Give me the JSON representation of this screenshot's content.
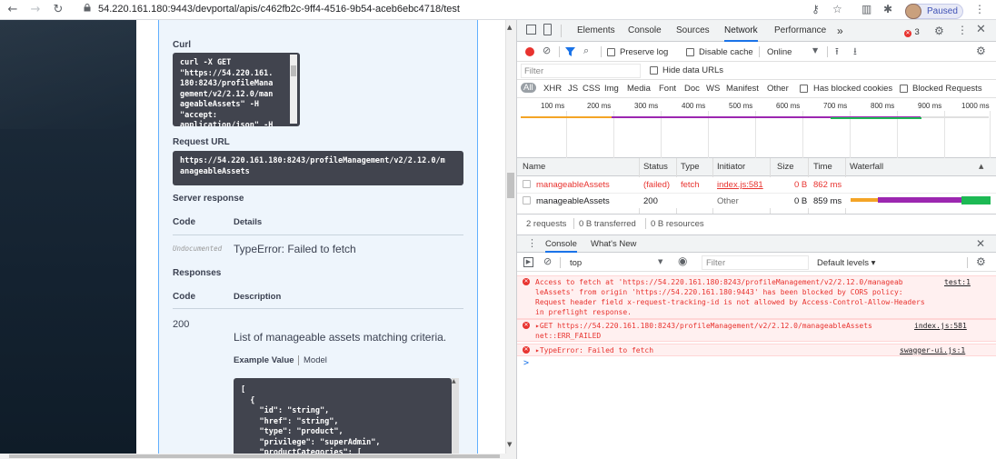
{
  "browser": {
    "url": "54.220.161.180:9443/devportal/apis/c462fb2c-9ff4-4516-9b54-aceb6ebc4718/test",
    "paused_label": "Paused"
  },
  "swagger": {
    "curl_heading": "Curl",
    "curl_code": "curl -X GET\n\"https://54.220.161.\n180:8243/profileMana\ngement/v2/2.12.0/man\nageableAssets\" -H\n\"accept:\napplication/json\" -H",
    "request_url_heading": "Request URL",
    "request_url": "https://54.220.161.180:8243/profileManagement/v2/2.12.0/m\nanageableAssets",
    "server_response_heading": "Server response",
    "code_col": "Code",
    "details_col": "Details",
    "undocumented": "Undocumented",
    "error_text": "TypeError: Failed to fetch",
    "responses_heading": "Responses",
    "code_col2": "Code",
    "description_col": "Description",
    "status_200": "200",
    "status_200_desc": "List of manageable assets matching criteria.",
    "example_value_tab": "Example Value",
    "model_tab": "Model",
    "example_json": "[\n  {\n    \"id\": \"string\",\n    \"href\": \"string\",\n    \"type\": \"product\",\n    \"privilege\": \"superAdmin\",\n    \"productCategories\": ["
  },
  "devtools": {
    "tabs": [
      "Elements",
      "Console",
      "Sources",
      "Network",
      "Performance"
    ],
    "active_tab": "Network",
    "more_tabs": "»",
    "error_count": "3",
    "preserve_log": "Preserve log",
    "disable_cache": "Disable cache",
    "throttle": "Online",
    "filter_placeholder": "Filter",
    "hide_data_urls": "Hide data URLs",
    "type_filters": [
      "All",
      "XHR",
      "JS",
      "CSS",
      "Img",
      "Media",
      "Font",
      "Doc",
      "WS",
      "Manifest",
      "Other"
    ],
    "has_blocked_cookies": "Has blocked cookies",
    "blocked_requests": "Blocked Requests",
    "ticks": [
      "100 ms",
      "200 ms",
      "300 ms",
      "400 ms",
      "500 ms",
      "600 ms",
      "700 ms",
      "800 ms",
      "900 ms",
      "1000 ms"
    ],
    "columns": [
      "Name",
      "Status",
      "Type",
      "Initiator",
      "Size",
      "Time",
      "Waterfall"
    ],
    "rows": [
      {
        "name": "manageableAssets",
        "status": "(failed)",
        "type": "fetch",
        "initiator": "index.js:581",
        "size": "0 B",
        "time": "862 ms",
        "failed": true
      },
      {
        "name": "manageableAssets",
        "status": "200",
        "type": "",
        "initiator": "Other",
        "size": "0 B",
        "time": "859 ms",
        "failed": false
      }
    ],
    "summary": [
      "2 requests",
      "0 B transferred",
      "0 B resources"
    ],
    "drawer_tabs": [
      "Console",
      "What's New"
    ],
    "context": "top",
    "console_filter_placeholder": "Filter",
    "default_levels": "Default levels ▾",
    "messages": [
      {
        "lines": [
          "Access to fetch at 'https://54.220.161.180:8243/profileManagement/v2/2.12.0/manageab",
          "leAssets' from origin 'https://54.220.161.180:9443' has been blocked by CORS policy:",
          "Request header field x-request-tracking-id is not allowed by Access-Control-Allow-Headers",
          "in preflight response."
        ],
        "source": "test:1"
      },
      {
        "lines": [
          "▸GET https://54.220.161.180:8243/profileManagement/v2/2.12.0/manageableAssets",
          "net::ERR_FAILED"
        ],
        "source": "index.js:581"
      },
      {
        "lines": [
          "▸TypeError: Failed to fetch"
        ],
        "source": "swagger-ui.js:1"
      }
    ],
    "prompt": ">"
  },
  "colors": {
    "accent": "#1a73e8",
    "error": "#e8332f",
    "swagger_blue": "#61affe"
  }
}
